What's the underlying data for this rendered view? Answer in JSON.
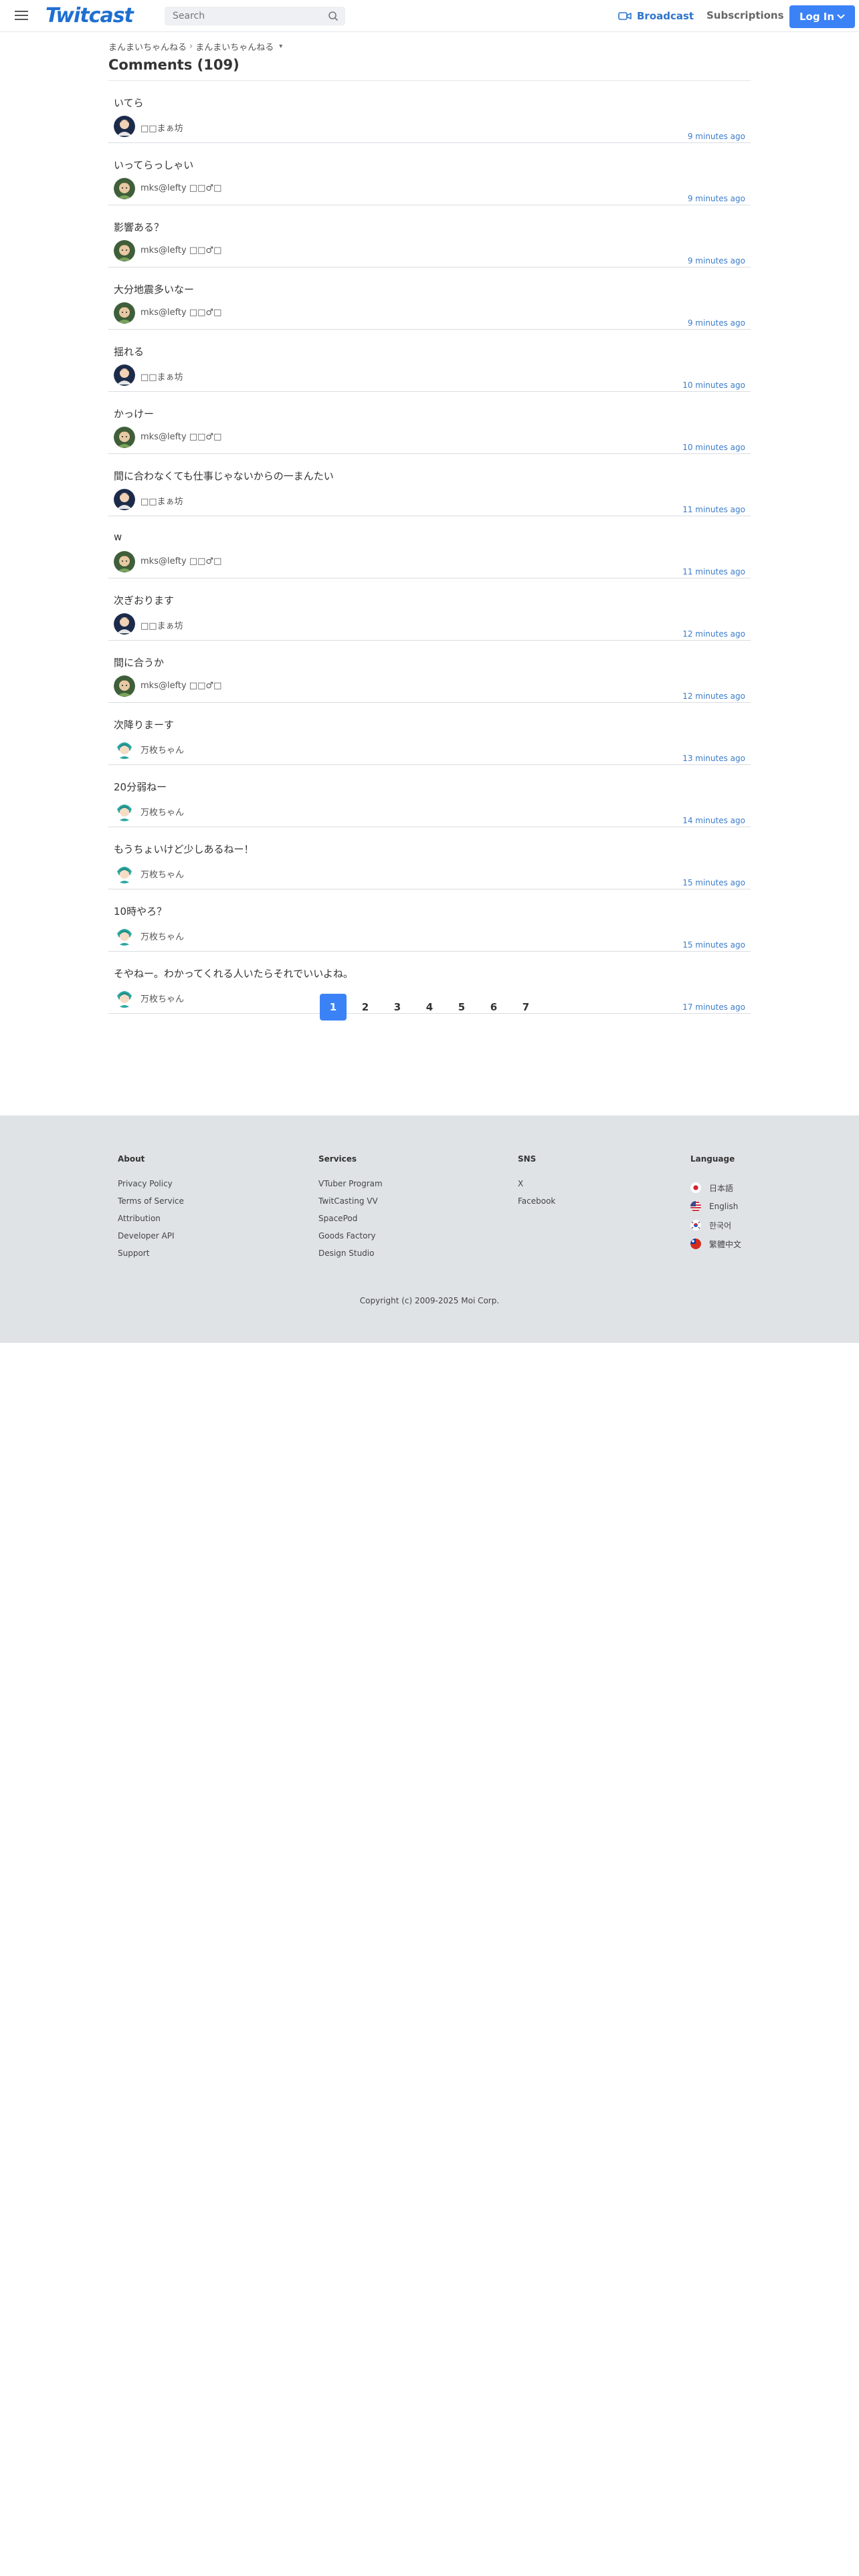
{
  "header": {
    "logo": "Twitcast",
    "search_placeholder": "Search",
    "broadcast_label": "Broadcast",
    "subscriptions_label": "Subscriptions",
    "login_label": "Log In",
    "accent_color": "#3b82f6"
  },
  "breadcrumb": [
    "まんまいちゃんねる",
    "まんまいちゃんねる"
  ],
  "page_title": "Comments (109)",
  "comments": [
    {
      "text": "いてら",
      "user": "□□まぁ坊",
      "time": "9 minutes ago",
      "avatar": "dark"
    },
    {
      "text": "いってらっしゃい",
      "user": "mks@lefty □□♂□",
      "time": "9 minutes ago",
      "avatar": "green"
    },
    {
      "text": "影響ある？",
      "user": "mks@lefty □□♂□",
      "time": "9 minutes ago",
      "avatar": "green"
    },
    {
      "text": "大分地震多いなー",
      "user": "mks@lefty □□♂□",
      "time": "9 minutes ago",
      "avatar": "green"
    },
    {
      "text": "揺れる",
      "user": "□□まぁ坊",
      "time": "10 minutes ago",
      "avatar": "dark"
    },
    {
      "text": "かっけー",
      "user": "mks@lefty □□♂□",
      "time": "10 minutes ago",
      "avatar": "green"
    },
    {
      "text": "間に合わなくても仕事じゃないからの一まんたい",
      "user": "□□まぁ坊",
      "time": "11 minutes ago",
      "avatar": "dark"
    },
    {
      "text": "w",
      "user": "mks@lefty □□♂□",
      "time": "11 minutes ago",
      "avatar": "green"
    },
    {
      "text": "次ぎおります",
      "user": "□□まぁ坊",
      "time": "12 minutes ago",
      "avatar": "dark"
    },
    {
      "text": "間に合うか",
      "user": "mks@lefty □□♂□",
      "time": "12 minutes ago",
      "avatar": "green"
    },
    {
      "text": "次降りまーす",
      "user": "万枚ちゃん",
      "time": "13 minutes ago",
      "avatar": "teal"
    },
    {
      "text": "20分弱ねー",
      "user": "万枚ちゃん",
      "time": "14 minutes ago",
      "avatar": "teal"
    },
    {
      "text": "もうちょいけど少しあるねー！",
      "user": "万枚ちゃん",
      "time": "15 minutes ago",
      "avatar": "teal"
    },
    {
      "text": "10時やろ？",
      "user": "万枚ちゃん",
      "time": "15 minutes ago",
      "avatar": "teal"
    },
    {
      "text": "そやねー。わかってくれる人いたらそれでいいよね。",
      "user": "万枚ちゃん",
      "time": "17 minutes ago",
      "avatar": "teal"
    }
  ],
  "pagination": [
    "1",
    "2",
    "3",
    "4",
    "5",
    "6",
    "7"
  ],
  "current_page": "1",
  "footer": {
    "about": {
      "title": "About",
      "links": [
        "Privacy Policy",
        "Terms of Service",
        "Attribution",
        "Developer API",
        "Support"
      ]
    },
    "services": {
      "title": "Services",
      "links": [
        "VTuber Program",
        "TwitCasting VV",
        "SpacePod",
        "Goods Factory",
        "Design Studio"
      ]
    },
    "sns": {
      "title": "SNS",
      "links": [
        "X",
        "Facebook"
      ]
    },
    "language": {
      "title": "Language",
      "links": [
        "日本語",
        "English",
        "한국어",
        "繁體中文"
      ]
    },
    "copyright": "Copyright (c) 2009-2025 Moi Corp."
  }
}
